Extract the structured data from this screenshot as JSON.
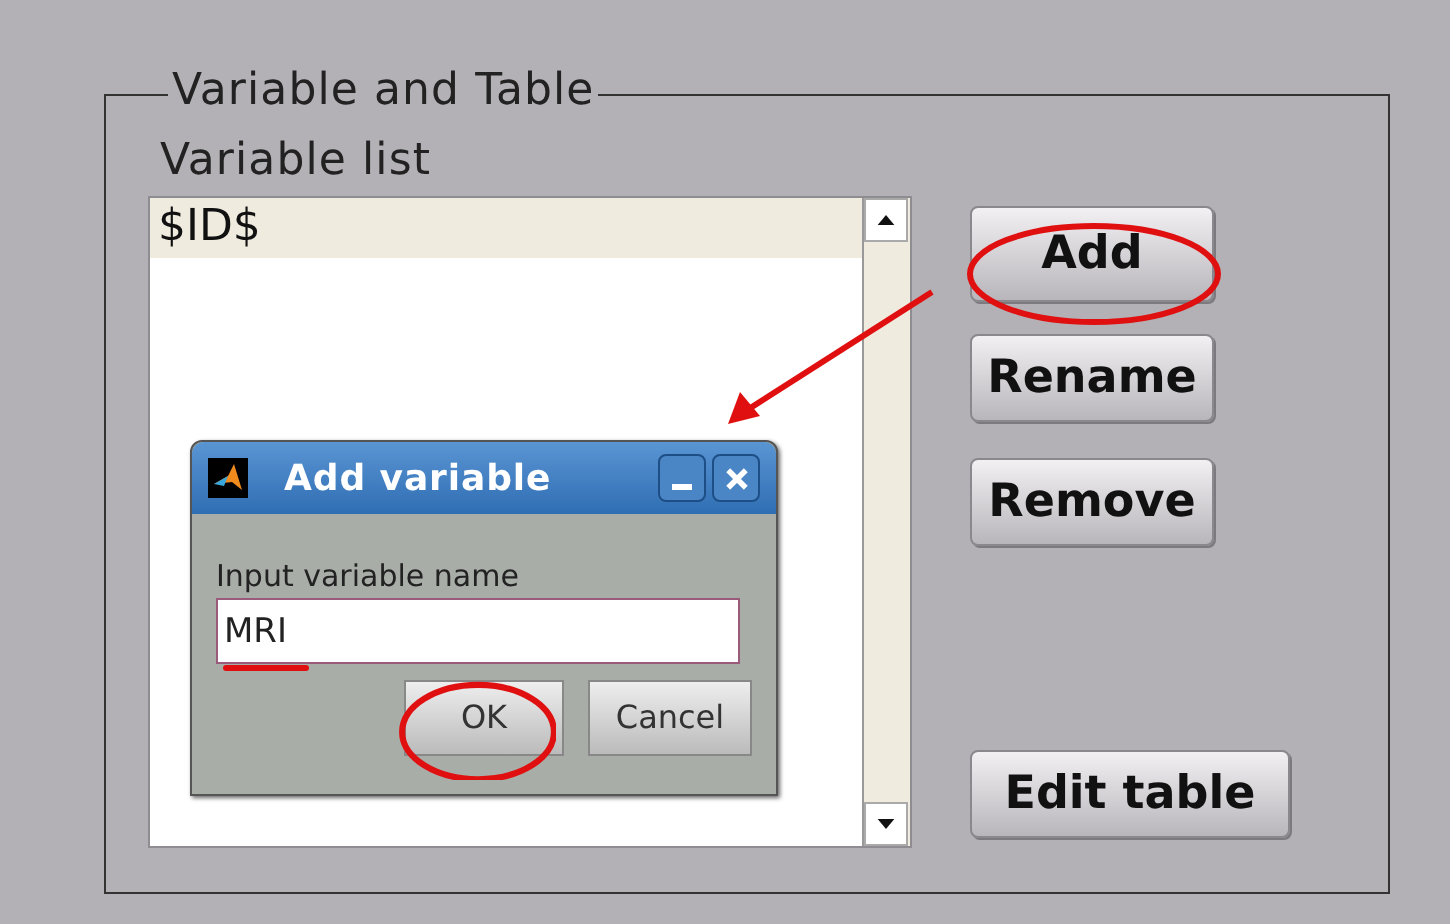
{
  "group": {
    "title": "Variable and Table"
  },
  "variable_list": {
    "label": "Variable list",
    "items": [
      {
        "text": "$ID$",
        "selected": true
      }
    ]
  },
  "buttons": [
    {
      "label": "Add"
    },
    {
      "label": "Rename"
    },
    {
      "label": "Remove"
    },
    {
      "label": "Edit table"
    }
  ],
  "dialog": {
    "title": "Add variable",
    "prompt": "Input variable name",
    "value": "MRI",
    "buttons": [
      {
        "label": "OK"
      },
      {
        "label": "Cancel"
      }
    ]
  }
}
